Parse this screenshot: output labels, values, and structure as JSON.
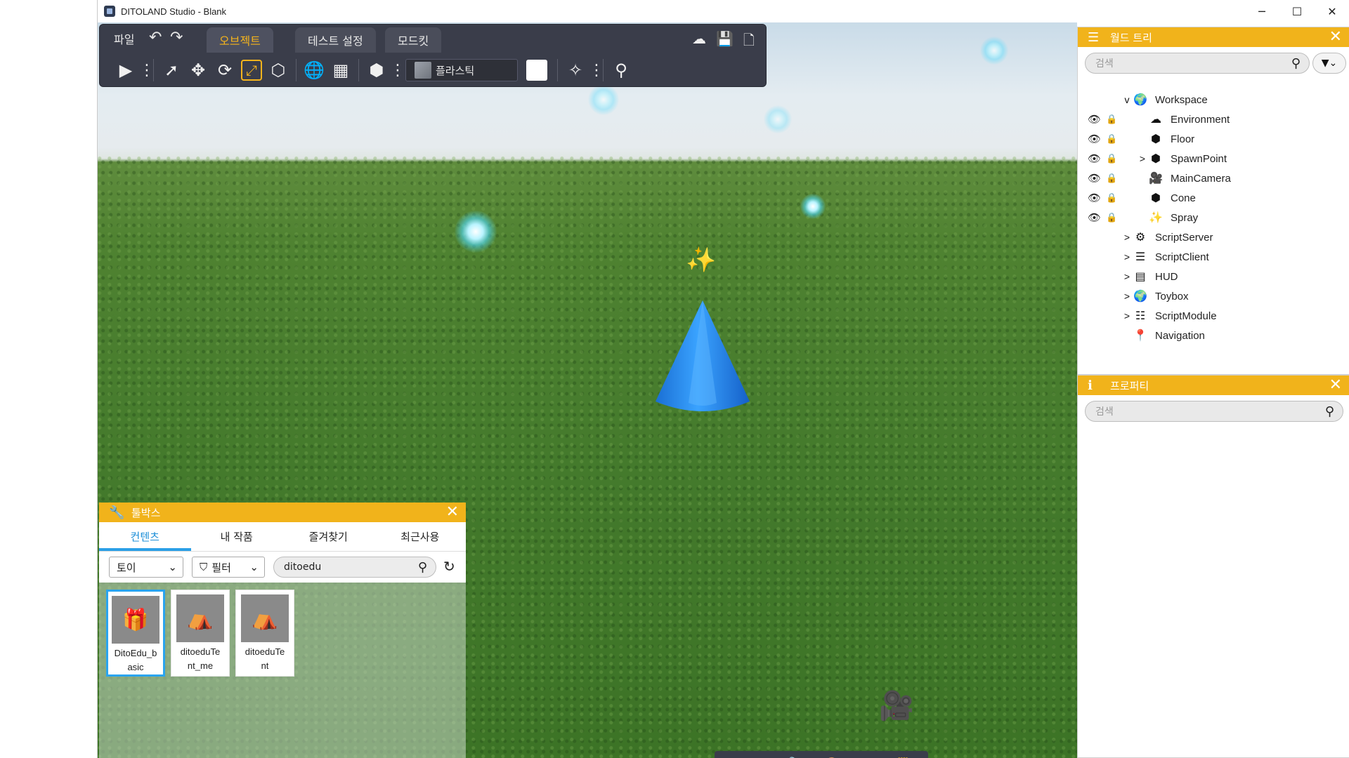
{
  "window": {
    "title": "DITOLAND Studio - Blank",
    "controls": [
      "─",
      "☐",
      "✕"
    ]
  },
  "toolbar": {
    "file_label": "파일",
    "tabs": [
      {
        "label": "오브젝트",
        "active": true
      },
      {
        "label": "테스트 설정",
        "active": false
      },
      {
        "label": "모드킷",
        "active": false
      }
    ],
    "material_label": "플라스틱",
    "accent_color": "#f5b41c"
  },
  "world_tree": {
    "title": "월드 트리",
    "search_placeholder": "검색",
    "items": [
      {
        "label": "Workspace",
        "icon": "workspace-icon",
        "expand": "v"
      },
      {
        "label": "Environment",
        "icon": "environment-icon",
        "expand": ""
      },
      {
        "label": "Floor",
        "icon": "part-icon",
        "expand": "",
        "locked": true
      },
      {
        "label": "SpawnPoint",
        "icon": "part-icon",
        "expand": ">"
      },
      {
        "label": "MainCamera",
        "icon": "camera-icon",
        "expand": ""
      },
      {
        "label": "Cone",
        "icon": "part-icon",
        "expand": ""
      },
      {
        "label": "Spray",
        "icon": "spray-icon",
        "expand": ""
      },
      {
        "label": "ScriptServer",
        "icon": "script-server-icon",
        "expand": ">"
      },
      {
        "label": "ScriptClient",
        "icon": "script-client-icon",
        "expand": ">"
      },
      {
        "label": "HUD",
        "icon": "hud-icon",
        "expand": ">"
      },
      {
        "label": "Toybox",
        "icon": "toybox-icon",
        "expand": ">"
      },
      {
        "label": "ScriptModule",
        "icon": "script-module-icon",
        "expand": ">"
      },
      {
        "label": "Navigation",
        "icon": "navigation-pin-icon",
        "expand": ""
      }
    ]
  },
  "properties": {
    "title": "프로퍼티",
    "search_placeholder": "검색"
  },
  "toolbox": {
    "title": "툴박스",
    "tabs": [
      {
        "label": "컨텐츠",
        "active": true
      },
      {
        "label": "내 작품",
        "active": false
      },
      {
        "label": "즐겨찾기",
        "active": false
      },
      {
        "label": "최근사용",
        "active": false
      }
    ],
    "category": "토이",
    "filter_label": "필터",
    "search_value": "ditoedu",
    "items": [
      {
        "name": "DitoEdu_basic",
        "display": "DitoEdu_b\nasic",
        "selected": true
      },
      {
        "name": "ditoeduTent_me",
        "display": "ditoeduTe\nnt_me",
        "selected": false
      },
      {
        "name": "ditoeduTent",
        "display": "ditoeduTe\nnt",
        "selected": false
      }
    ]
  },
  "dock": {
    "icons": [
      "list-icon",
      "info-icon",
      "wrench-icon",
      "palette-icon",
      "edit-icon",
      "notes-icon"
    ]
  }
}
